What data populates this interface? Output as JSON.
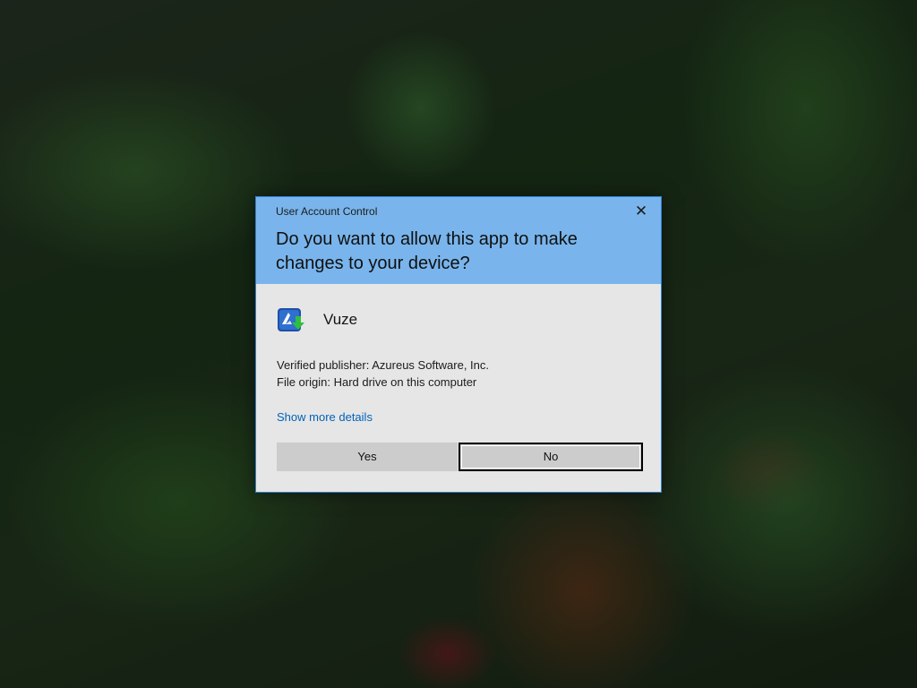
{
  "dialog": {
    "title": "User Account Control",
    "close_glyph": "✕",
    "question": "Do you want to allow this app to make changes to your device?",
    "app_name": "Vuze",
    "app_icon": "vuze-logo-icon",
    "publisher": "Verified publisher: Azureus Software, Inc.",
    "file_origin": "File origin: Hard drive on this computer",
    "details_link": "Show more details",
    "yes_label": "Yes",
    "no_label": "No",
    "default_button": "No"
  },
  "colors": {
    "header": "#79b5ec",
    "body": "#e6e6e6",
    "border": "#2f7fd0",
    "link": "#0063b8",
    "button": "#cccccc"
  }
}
